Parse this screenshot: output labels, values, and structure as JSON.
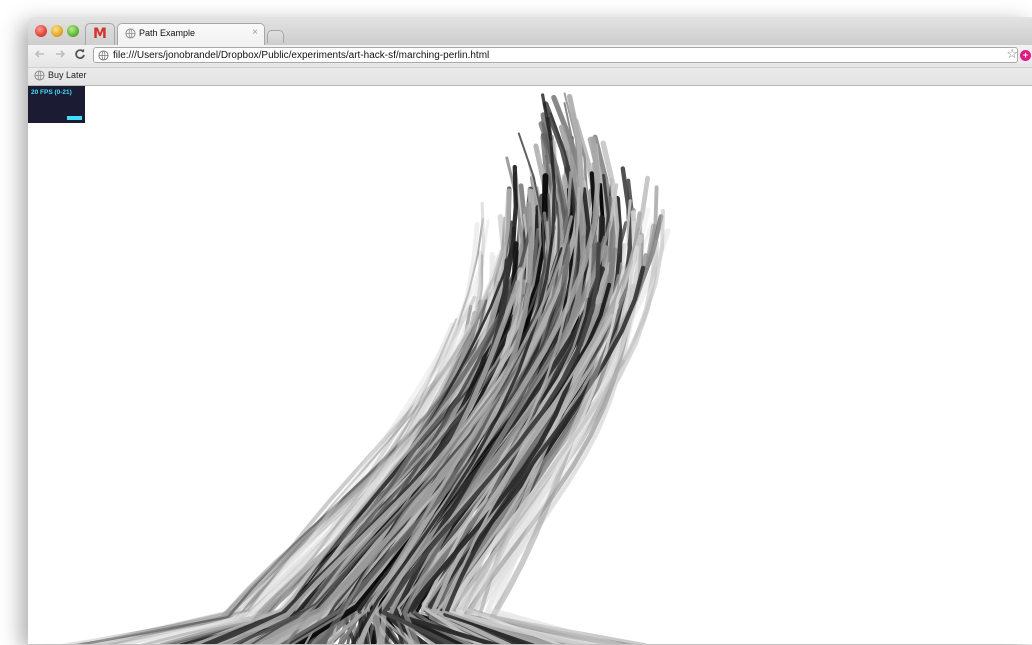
{
  "browser": {
    "tabs": [
      {
        "label": "M",
        "icon": "gmail-icon"
      },
      {
        "label": "Path Example",
        "icon": "globe-icon"
      }
    ],
    "address_bar": {
      "url": "file:///Users/jonobrandel/Dropbox/Public/experiments/art-hack-sf/marching-perlin.html"
    },
    "bookmarks": [
      {
        "label": "Buy Later",
        "icon": "globe-icon"
      }
    ],
    "close_glyph": "×"
  },
  "page": {
    "fps_label": "20 FPS (0-21)"
  },
  "colors": {
    "fps_bg": "#1b1b33",
    "fps_accent": "#3fe0ff",
    "gmail_red": "#d4342a",
    "extension_pink": "#e01b84"
  }
}
